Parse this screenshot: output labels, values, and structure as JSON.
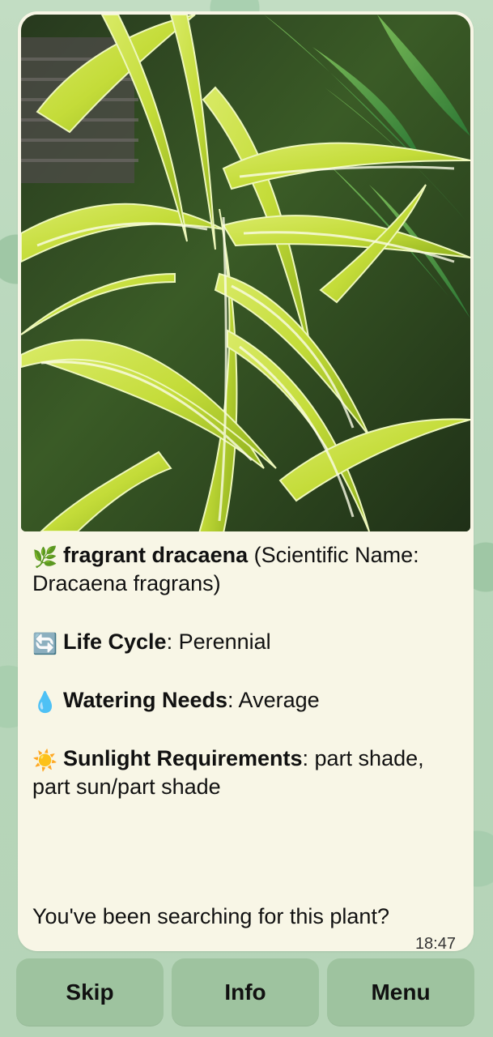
{
  "message": {
    "plant_icon": "🌿",
    "common_name": "fragrant dracaena",
    "scientific_prefix": " (Scientific Name: ",
    "scientific_name": "Dracaena fragrans",
    "scientific_suffix": ")",
    "life_cycle_icon": "🔄",
    "life_cycle_label": "Life Cycle",
    "life_cycle_value": ": Perennial",
    "watering_icon": "💧",
    "watering_label": "Watering Needs",
    "watering_value": ": Average",
    "sunlight_icon": "☀️",
    "sunlight_label": "Sunlight Requirements",
    "sunlight_value": ": part shade, part sun/part shade",
    "question": "You've been searching for this plant?",
    "time": "18:47"
  },
  "actions": {
    "skip": "Skip",
    "info": "Info",
    "menu": "Menu"
  },
  "colors": {
    "background": "#b9d8bd",
    "bubble": "#f8f6e6",
    "button": "#9ec39f"
  }
}
